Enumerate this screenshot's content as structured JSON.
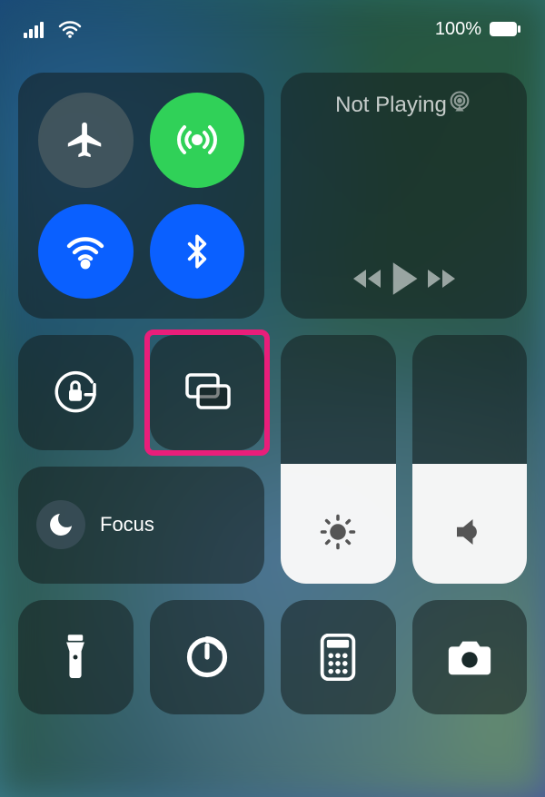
{
  "status": {
    "battery_percent": "100%"
  },
  "connectivity": {
    "airplane": {
      "active": false
    },
    "cellular": {
      "active": true
    },
    "wifi": {
      "active": true
    },
    "bluetooth": {
      "active": true
    }
  },
  "media": {
    "title": "Not Playing"
  },
  "focus": {
    "label": "Focus",
    "active": false
  },
  "sliders": {
    "brightness_percent": 48,
    "volume_percent": 48
  },
  "highlight": "screen-mirroring",
  "colors": {
    "highlight_border": "#e91e7a",
    "active_green": "#30d158",
    "active_blue": "#0a60ff"
  }
}
